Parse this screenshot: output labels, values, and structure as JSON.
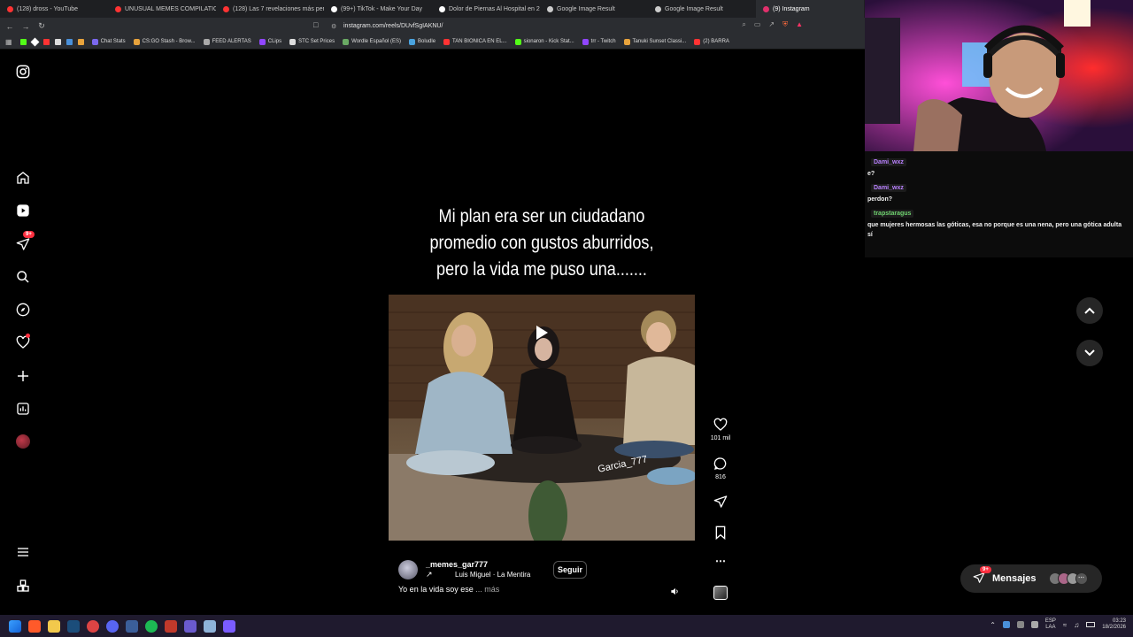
{
  "tabs": [
    {
      "label": "(128) dross - YouTube",
      "color": "#ff3333"
    },
    {
      "label": "UNUSUAL MEMES COMPILATION V3",
      "color": "#ff3333"
    },
    {
      "label": "(128) Las 7 revelaciones más perturb",
      "color": "#ff3333"
    },
    {
      "label": "(99+) TikTok - Make Your Day",
      "color": "#ffffff"
    },
    {
      "label": "Dolor de Piernas Al Hospital en 2023",
      "color": "#ffffff"
    },
    {
      "label": "Google Image Result",
      "color": "#cccccc"
    },
    {
      "label": "Google Image Result",
      "color": "#cccccc"
    },
    {
      "label": "(9) Instagram",
      "color": "#e1306c"
    }
  ],
  "address": {
    "url": "instagram.com/reels/DUvfSgIAKNU/"
  },
  "bookmarks": [
    {
      "label": "Chat Stats",
      "color": "#7b68ee"
    },
    {
      "label": "CS:GO Stash - Brow...",
      "color": "#e8a33c"
    },
    {
      "label": "FEED ALERTAS",
      "color": "#aaaaaa"
    },
    {
      "label": "CLips",
      "color": "#9146ff"
    },
    {
      "label": "STC Set Prices",
      "color": "#dddddd"
    },
    {
      "label": "Wordle Español (ES)",
      "color": "#6aaa64"
    },
    {
      "label": "Boludle",
      "color": "#4aa3df"
    },
    {
      "label": "TAN BIONICA EN EL...",
      "color": "#ff3333"
    },
    {
      "label": "sionaron - Kick Stat...",
      "color": "#53fc18"
    },
    {
      "label": "trr - Twitch",
      "color": "#9146ff"
    },
    {
      "label": "Tanuki Sunset Classi...",
      "color": "#e8a33c"
    },
    {
      "label": "(2) BARRA",
      "color": "#ff3333"
    }
  ],
  "sidebar": {
    "notifications_badge": "9+"
  },
  "reel": {
    "caption_lines": [
      "Mi plan era ser un ciudadano",
      "promedio con gustos aburridos,",
      "pero la vida me puso una......."
    ],
    "watermark": "Garcia_777",
    "username": "_memes_gar777",
    "audio": "Luis Miguel · La Mentira",
    "follow_label": "Seguir",
    "description": "Yo en la vida soy ese",
    "more_label": "... más",
    "likes": "101 mil",
    "comments": "816"
  },
  "messages": {
    "label": "Mensajes",
    "badge": "9+"
  },
  "chat": [
    {
      "user": "Dami_wxz",
      "color": "#b980ff",
      "message": "e?"
    },
    {
      "user": "Dami_wxz",
      "color": "#b980ff",
      "message": "perdon?"
    },
    {
      "user": "trapstaragus",
      "color": "#6fd26f",
      "message": "que mujeres hermosas las góticas, esa no porque es una nena, pero una gótica adulta sí"
    }
  ],
  "taskbar": {
    "lang": "ESP",
    "lang_sub": "LAA",
    "time": "03:23",
    "date": "18/2/2026"
  }
}
